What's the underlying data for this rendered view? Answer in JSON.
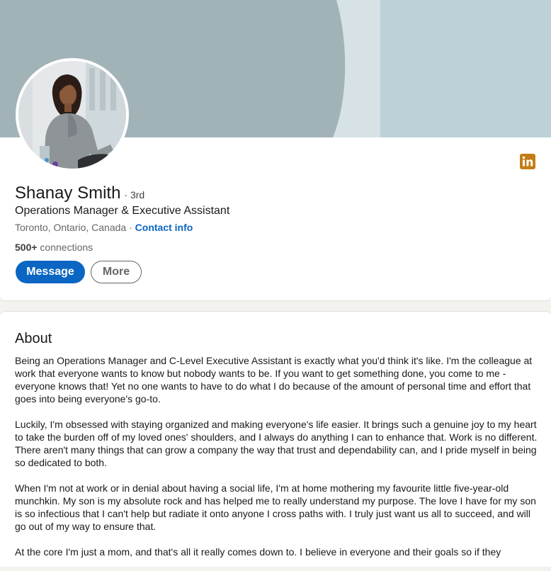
{
  "profile": {
    "name": "Shanay Smith",
    "degree": "· 3rd",
    "headline": "Operations Manager & Executive Assistant",
    "location": "Toronto, Ontario, Canada",
    "separator": " · ",
    "contact_label": "Contact info",
    "connections_count": "500+",
    "connections_label": " connections",
    "badge_icon": "linkedin-icon"
  },
  "actions": {
    "message_label": "Message",
    "more_label": "More"
  },
  "about": {
    "title": "About",
    "paragraphs": [
      "Being an Operations Manager and C-Level Executive Assistant is exactly what you'd think it's like. I'm the colleague at work that everyone wants to know but nobody wants to be. If you want to get something done, you come to me - everyone knows that! Yet no one wants to have to do what I do because of the amount of personal time and effort that goes into being everyone's go-to.",
      "Luckily, I'm obsessed with staying organized and making everyone's life easier. It brings such a genuine joy to my heart to take the burden off of my loved ones' shoulders, and I always do anything I can to enhance that. Work is no different. There aren't many things that can grow a company the way that trust and dependability can, and I pride myself in being so dedicated to both.",
      "When I'm not at work or in denial about having a social life, I'm at home mothering my favourite little five-year-old munchkin. My son is my absolute rock and has helped me to really understand my purpose. The love I have for my son is so infectious that I can't help but radiate it onto anyone I cross paths with. I truly just want us all to succeed, and will go out of my way to ensure that.",
      "At the core I'm just a mom, and that's all it really comes down to. I believe in everyone and their goals so if they"
    ]
  },
  "colors": {
    "accent": "#0a66c2",
    "badge": "#c37d16",
    "banner_left": "#a1b3b7",
    "banner_mid": "#d6e2e5",
    "banner_right": "#bcd1d8"
  }
}
